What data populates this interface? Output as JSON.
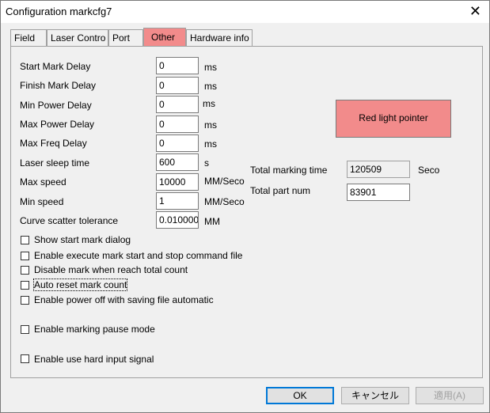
{
  "window": {
    "title": "Configuration markcfg7",
    "close_icon": "close-icon"
  },
  "tabs": [
    {
      "label": "Field"
    },
    {
      "label": "Laser Contro"
    },
    {
      "label": "Port"
    },
    {
      "label": "Other",
      "active": true
    },
    {
      "label": "Hardware info"
    }
  ],
  "fields": [
    {
      "label": "Start Mark Delay",
      "value": "0",
      "unit": "ms"
    },
    {
      "label": "Finish Mark Delay",
      "value": "0",
      "unit": "ms"
    },
    {
      "label": "Min Power Delay",
      "value": "0",
      "unit": "ms"
    },
    {
      "label": "Max Power Delay",
      "value": "0",
      "unit": "ms"
    },
    {
      "label": "Max Freq Delay",
      "value": "0",
      "unit": "ms"
    },
    {
      "label": "Laser sleep time",
      "value": "600",
      "unit": "s"
    },
    {
      "label": "Max speed",
      "value": "10000",
      "unit": "MM/Seco"
    },
    {
      "label": "Min speed",
      "value": "1",
      "unit": "MM/Seco"
    },
    {
      "label": "Curve scatter tolerance",
      "value": "0.010000",
      "unit": "MM"
    }
  ],
  "red_light_button": "Red light pointer",
  "total_marking_time": {
    "label": "Total marking time",
    "value": "120509",
    "unit": "Secor"
  },
  "total_part_num": {
    "label": "Total part num",
    "value": "83901"
  },
  "checkboxes": [
    {
      "label": "Show start mark dialog",
      "checked": false
    },
    {
      "label": "Enable execute mark start and stop command file",
      "checked": false
    },
    {
      "label": "Disable mark when reach total count",
      "checked": false
    },
    {
      "label": "Auto reset mark count",
      "checked": false
    },
    {
      "label": "Enable power off with saving file automatic",
      "checked": false
    },
    {
      "label": "Enable marking pause mode",
      "checked": false
    },
    {
      "label": "Enable use hard input signal",
      "checked": false
    }
  ],
  "footer": {
    "ok": "OK",
    "cancel": "キャンセル",
    "apply": "適用(A)"
  },
  "colors": {
    "accent_red": "#f28b8b",
    "focus_blue": "#0078d7"
  }
}
